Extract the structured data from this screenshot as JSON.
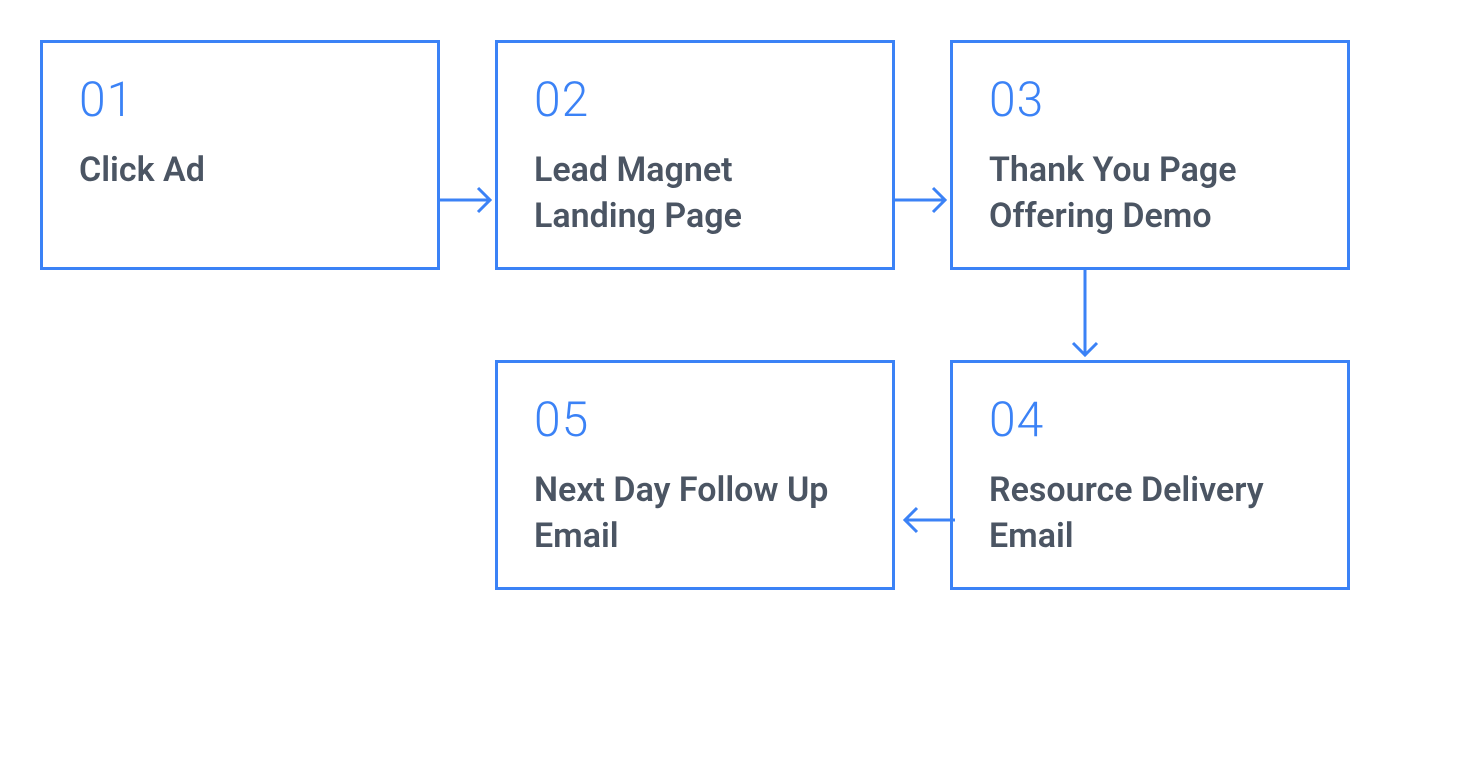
{
  "steps": [
    {
      "number": "01",
      "label": "Click Ad"
    },
    {
      "number": "02",
      "label": "Lead Magnet Landing Page"
    },
    {
      "number": "03",
      "label": "Thank You Page Offering Demo"
    },
    {
      "number": "04",
      "label": "Resource Delivery Email"
    },
    {
      "number": "05",
      "label": "Next Day Follow Up Email"
    }
  ],
  "colors": {
    "accent": "#3b82f6",
    "text": "#4b5563"
  }
}
